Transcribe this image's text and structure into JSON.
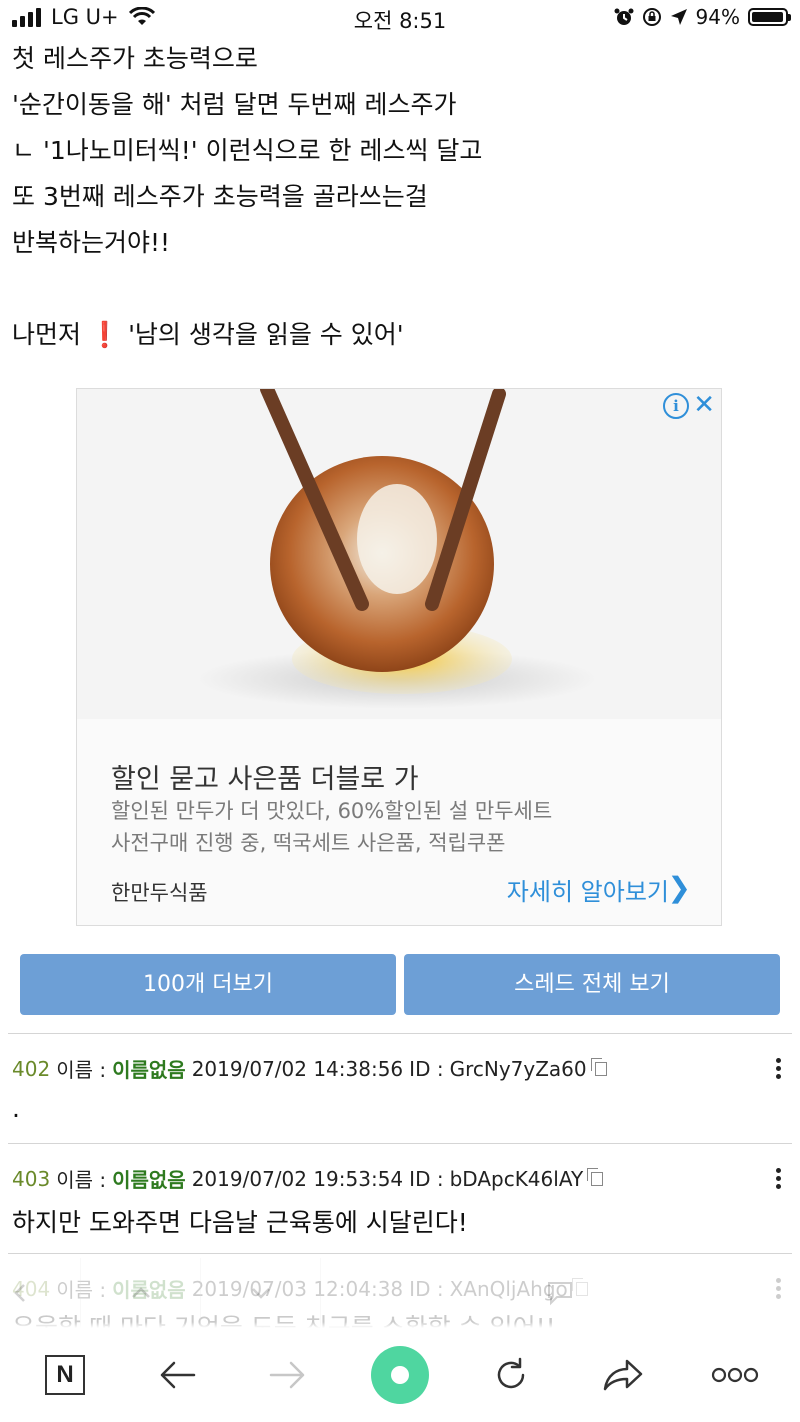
{
  "status_bar": {
    "carrier": "LG U+",
    "time": "오전 8:51",
    "battery": "94%",
    "battery_level": 0.94
  },
  "post": {
    "lines": [
      "첫 레스주가 초능력으로",
      "'순간이동을 해' 처럼 달면 두번째 레스주가",
      "ㄴ '1나노미터씩!' 이런식으로 한 레스씩 달고",
      "또 3번째 레스주가 초능력을 골라쓰는걸",
      "반복하는거야!!"
    ],
    "last_line_before": "나먼저",
    "last_line_emoji": "❗",
    "last_line_after": "'남의 생각을 읽을 수 있어'"
  },
  "ad": {
    "headline": "할인 묻고 사은품 더블로 가",
    "desc_line1": "할인된 만두가 더 맛있다, 60%할인된 설 만두세트",
    "desc_line2": "사전구매 진행 중, 떡국세트 사은품, 적립쿠폰",
    "brand": "한만두식품",
    "cta": "자세히 알아보기",
    "info_glyph": "i",
    "close_glyph": "✕",
    "cta_glyph": "❯"
  },
  "buttons": {
    "more": "100개 더보기",
    "thread": "스레드 전체 보기"
  },
  "comments": [
    {
      "num": "402",
      "name_label": "이름 :",
      "name": "이름없음",
      "datetime": "2019/07/02 14:38:56",
      "id_label": "ID :",
      "id": "GrcNy7yZa60",
      "body": "."
    },
    {
      "num": "403",
      "name_label": "이름 :",
      "name": "이름없음",
      "datetime": "2019/07/02 19:53:54",
      "id_label": "ID :",
      "id": "bDApcK46lAY",
      "body": "하지만 도와주면 다음날 근육통에 시달린다!"
    },
    {
      "num": "404",
      "name_label": "이름 :",
      "name": "이름없음",
      "datetime": "2019/07/03 12:04:38",
      "id_label": "ID :",
      "id": "XAnQljAhgo",
      "body": "우울할 때 마다 기억을 도둑 친구를 소환할 수 있어!!"
    }
  ],
  "toolbar": {
    "n_label": "N",
    "icons": [
      "naver-icon",
      "back-arrow-icon",
      "forward-arrow-icon",
      "record-icon",
      "refresh-icon",
      "share-icon",
      "more-icon"
    ]
  }
}
